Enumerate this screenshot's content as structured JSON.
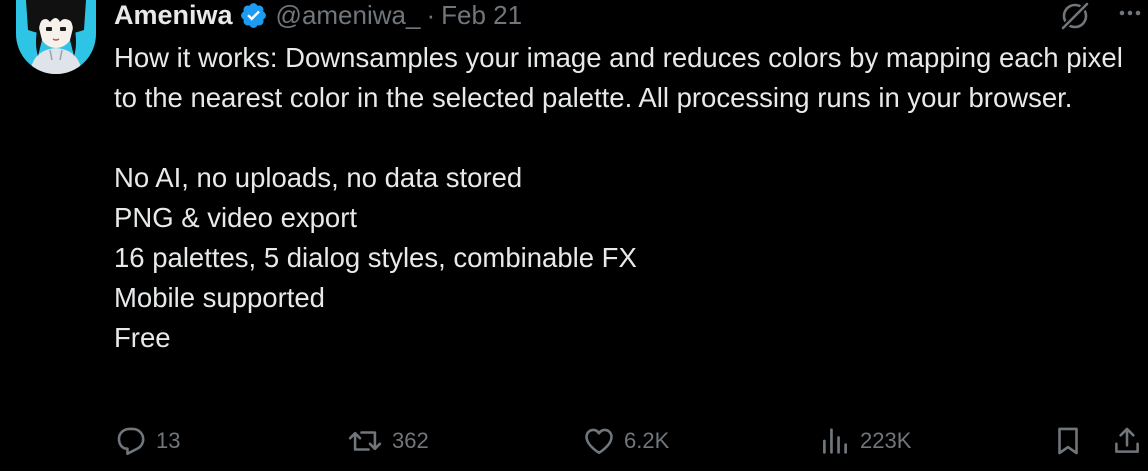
{
  "tweet": {
    "author": {
      "display_name": "Ameniwa",
      "handle": "@ameniwa_",
      "verified": true
    },
    "separator": "·",
    "date": "Feb 21",
    "body": "How it works: Downsamples your image and reduces colors by mapping each pixel to the nearest color in the selected palette. All processing runs in your browser.\n\nNo AI, no uploads, no data stored\nPNG & video export\n16 palettes, 5 dialog styles, combinable FX\nMobile supported\nFree",
    "stats": {
      "replies": "13",
      "reposts": "362",
      "likes": "6.2K",
      "views": "223K"
    }
  },
  "icons": {
    "verified": "verified-badge-icon",
    "grok": "grok-icon",
    "more": "more-icon",
    "reply": "reply-icon",
    "repost": "repost-icon",
    "like": "like-icon",
    "views": "views-icon",
    "bookmark": "bookmark-icon",
    "share": "share-icon"
  },
  "colors": {
    "background": "#000000",
    "text_primary": "#e7e9ea",
    "text_secondary": "#71767b",
    "verified_blue": "#1d9bf0",
    "avatar_bg": "#2ec4e6"
  }
}
